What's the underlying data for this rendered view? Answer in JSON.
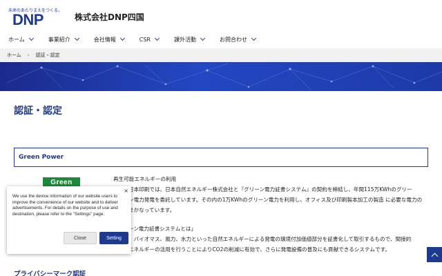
{
  "header": {
    "logo_tagline": "未来のあたりまえをつくる。",
    "logo_mark": "DNP",
    "company_name": "株式会社DNP四国"
  },
  "nav": {
    "items": [
      {
        "label": "ホーム"
      },
      {
        "label": "事業紹介"
      },
      {
        "label": "会社情報"
      },
      {
        "label": "CSR"
      },
      {
        "label": "課外活動"
      },
      {
        "label": "お問合わせ"
      }
    ]
  },
  "breadcrumb": {
    "home": "ホーム",
    "separator": "›",
    "current": "認証・認定"
  },
  "page": {
    "title": "認証・認定"
  },
  "section_green": {
    "heading": "Green Power",
    "logo_text": "Green",
    "p1_line1": "再生可能エネルギーの利用",
    "p1_line2": "日本印刷では、日本自然エネルギー株式会社と『グリーン電力証書システム』の契約を締結し、年間115万KWhのグリー",
    "p1_line3": "ン電力発電を委託しています。その内の1万KWhのグリーン電力を利用し、オフィス及び印刷製本加工の製造 に必要な電力の",
    "p1_line4": "まかなっています。",
    "p2_line1": "ーン電力証書システムとは」",
    "p2_line2": "、バイオマス、風力、水力といった自然エネルギーによる発電の環境付加価値部分を証書化して取引するもので、間接的",
    "p2_line3": "エネルギーの活用を行うことによりCO2の削減に有効で、さらに発電設備の普及にも貢献できるシステムです。"
  },
  "section_privacy": {
    "heading": "プライバシーマーク認証"
  },
  "cookie": {
    "close_x": "×",
    "message": "We use the device information of our website users to improve the convenience of our website and to deliver advertisements. For details on the purpose of use and destination, please refer to the \"Settings\" page.",
    "close_label": "Close",
    "setting_label": "Setting"
  },
  "icons": {
    "scroll_top": "chevron-up-icon",
    "nav_chevron": "chevron-down-icon"
  },
  "colors": {
    "brand": "#1d3a8f",
    "banner": "#2347c2",
    "green_logo": "#1c8a3a"
  }
}
